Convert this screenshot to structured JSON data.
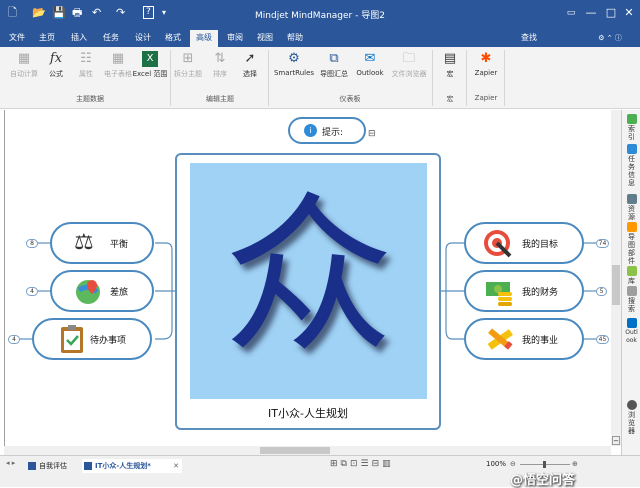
{
  "window": {
    "title": "Mindjet MindManager - 导图2",
    "help_btn": "?",
    "minimize": "—",
    "maximize": "□",
    "close": "✕"
  },
  "tabs": [
    "文件",
    "主页",
    "插入",
    "任务",
    "设计",
    "格式",
    "高级",
    "审阅",
    "视图",
    "帮助"
  ],
  "active_tab": "高级",
  "search_label": "查找",
  "ribbon": {
    "groups": [
      "主题数据",
      "编辑主题",
      "仪表板",
      "宏",
      "Zapier"
    ],
    "buttons": [
      {
        "label": "自动计算",
        "icon": "calc-icon",
        "enabled": false
      },
      {
        "label": "公式",
        "icon": "formula-icon",
        "enabled": true
      },
      {
        "label": "属性",
        "icon": "properties-icon",
        "enabled": false
      },
      {
        "label": "电子表格",
        "icon": "spreadsheet-icon",
        "enabled": false
      },
      {
        "label": "Excel 范围",
        "icon": "excel-icon",
        "enabled": true
      },
      {
        "label": "拆分主题",
        "icon": "split-icon",
        "enabled": false
      },
      {
        "label": "排序",
        "icon": "sort-icon",
        "enabled": false
      },
      {
        "label": "选择",
        "icon": "select-icon",
        "enabled": true
      },
      {
        "label": "SmartRules",
        "icon": "smartrules-icon",
        "enabled": true
      },
      {
        "label": "导图汇总",
        "icon": "map-rollup-icon",
        "enabled": true
      },
      {
        "label": "Outlook",
        "icon": "outlook-icon",
        "enabled": true
      },
      {
        "label": "文件浏览器",
        "icon": "file-browser-icon",
        "enabled": false
      },
      {
        "label": "宏",
        "icon": "macro-icon",
        "enabled": true
      },
      {
        "label": "Zapier",
        "icon": "zapier-icon",
        "enabled": true
      }
    ]
  },
  "side_panel": [
    "索引",
    "任务信息",
    "资源",
    "导图部件",
    "库",
    "搜索",
    "Outlook",
    "浏览器"
  ],
  "map": {
    "tip": "提示:",
    "central": {
      "glyph": "众",
      "label": "IT小众-人生规划"
    },
    "left_topics": [
      {
        "label": "平衡",
        "count": "8",
        "icon": "scales-icon"
      },
      {
        "label": "差旅",
        "count": "4",
        "icon": "map-pin-icon"
      },
      {
        "label": "待办事项",
        "count": "4",
        "icon": "clipboard-icon"
      }
    ],
    "right_topics": [
      {
        "label": "我的目标",
        "count": "74",
        "icon": "target-icon"
      },
      {
        "label": "我的财务",
        "count": "5",
        "icon": "money-icon"
      },
      {
        "label": "我的事业",
        "count": "45",
        "icon": "pencil-ruler-icon"
      }
    ]
  },
  "doc_tabs": [
    "自我评估",
    "IT小众-人生规划*"
  ],
  "doc_tab_close": "✕",
  "zoom": "100%",
  "watermark": "@悟空问答",
  "colors": {
    "accent": "#2b579a",
    "topic_border": "#4a8ac0",
    "central_bg": "#9fd2f5"
  }
}
